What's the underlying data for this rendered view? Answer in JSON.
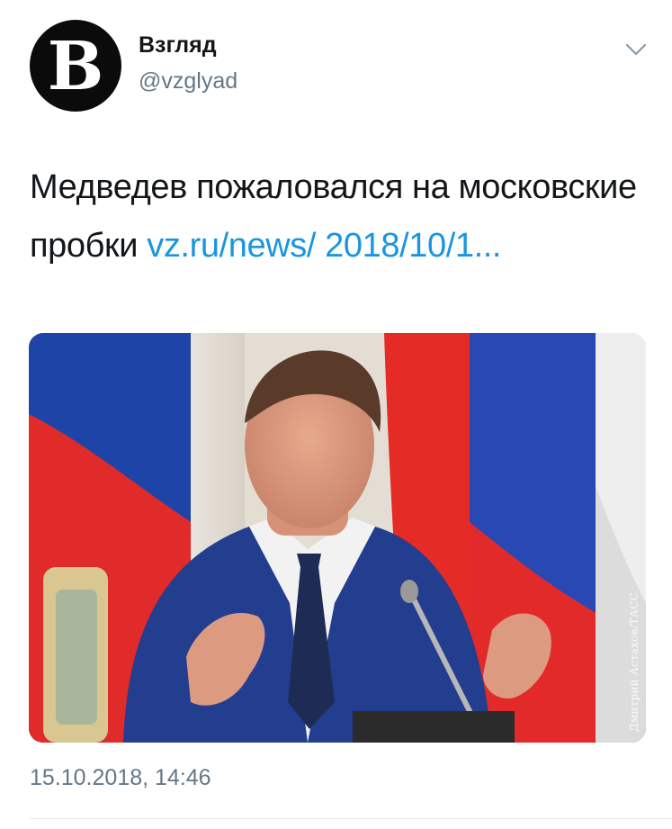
{
  "author": {
    "avatar_letter": "B",
    "display_name": "Взгляд",
    "handle": "@vzglyad"
  },
  "menu": {
    "icon": "chevron-down-icon"
  },
  "tweet": {
    "text": "Медведев пожаловался на московские пробки ",
    "link": "vz.ru/news/ 2018/10/1..."
  },
  "media": {
    "credit": "Дмитрий Астахов/ТАСС"
  },
  "timestamp": "15.10.2018, 14:46",
  "colors": {
    "link": "#1b95e0",
    "secondary_text": "#657786"
  }
}
